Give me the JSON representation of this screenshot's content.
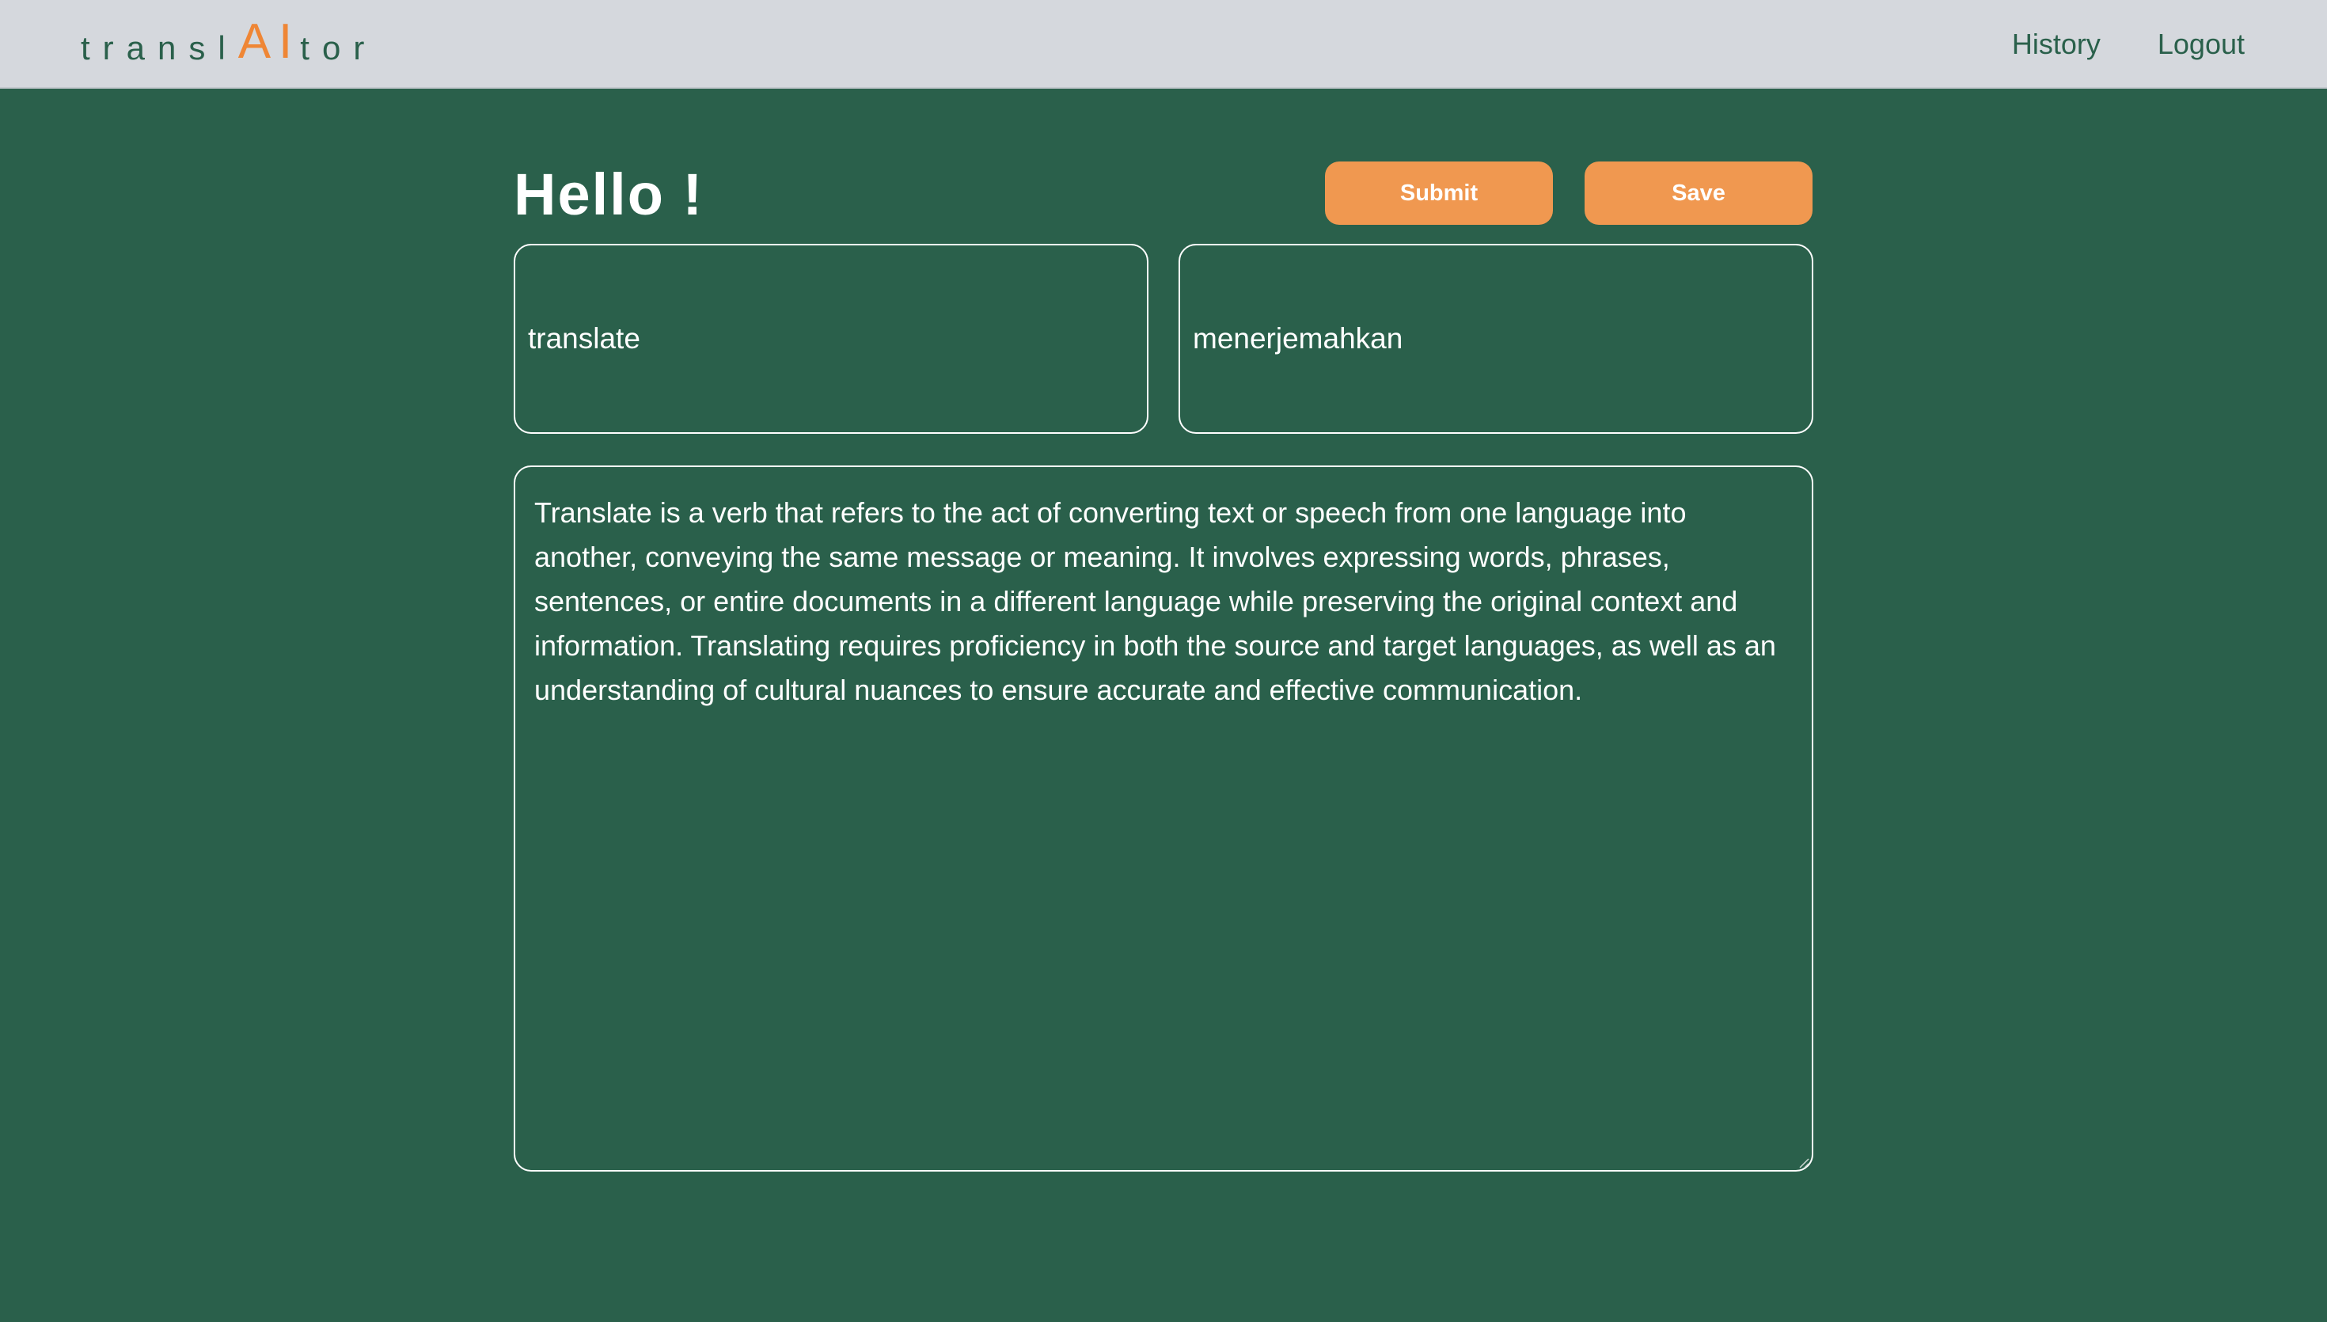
{
  "header": {
    "logo": {
      "part1": "transl",
      "part2": "AI",
      "part3": "tor"
    },
    "nav": {
      "history_label": "History",
      "logout_label": "Logout"
    }
  },
  "main": {
    "greeting": "Hello !",
    "submit_label": "Submit",
    "save_label": "Save",
    "source_word": "translate",
    "translated_word": "menerjemahkan",
    "definition": "Translate is a verb that refers to the act of converting text or speech from one language into another, conveying the same message or meaning. It involves expressing words, phrases, sentences, or entire documents in a different language while preserving the original context and information. Translating requires proficiency in both the source and target languages, as well as an understanding of cultural nuances to ensure accurate and effective communication."
  },
  "colors": {
    "background": "#2a604b",
    "navbar": "#d5d8dd",
    "accent": "#f09850",
    "logo_accent": "#ef8635",
    "text_light": "#ffffff"
  }
}
